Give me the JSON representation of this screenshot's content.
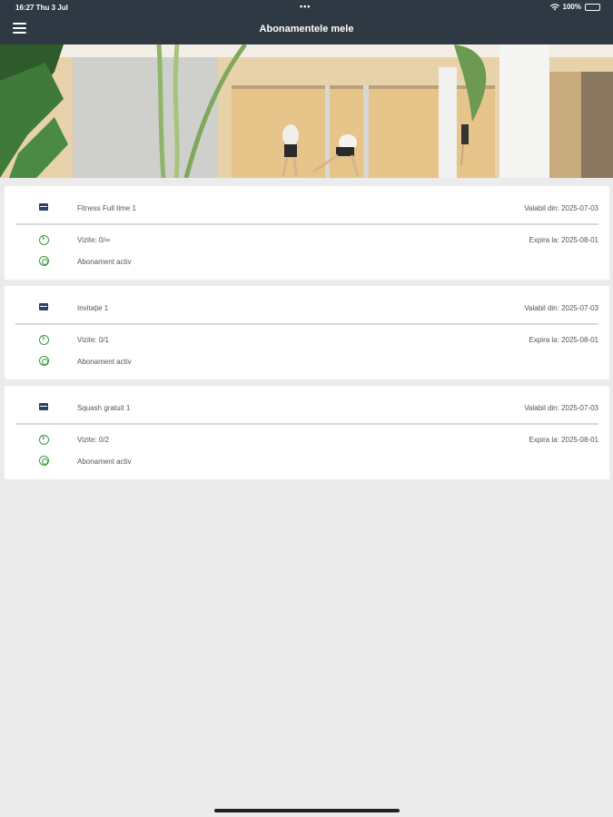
{
  "status": {
    "time_date": "16:27  Thu 3 Jul",
    "dots": "•••",
    "battery": "100%"
  },
  "nav": {
    "title": "Abonamentele mele",
    "menu_icon": "hamburger-menu-icon"
  },
  "hero": {
    "image": "squash-court-photo"
  },
  "subscriptions": [
    {
      "name": "Fitness Full time 1",
      "valid_from": "Valabil din: 2025-07-03",
      "visits": "Vizite: 0/∞",
      "expires": "Expira la: 2025-08-01",
      "status": "Abonament activ"
    },
    {
      "name": "Invitație 1",
      "valid_from": "Valabil din: 2025-07-03",
      "visits": "Vizite: 0/1",
      "expires": "Expira la: 2025-08-01",
      "status": "Abonament activ"
    },
    {
      "name": "Squash gratuit 1",
      "valid_from": "Valabil din: 2025-07-03",
      "visits": "Vizite: 0/2",
      "expires": "Expira la: 2025-08-01",
      "status": "Abonament activ"
    }
  ],
  "colors": {
    "header_bg": "#2f3943",
    "page_bg": "#ebebeb",
    "accent_green": "#3a9b3a",
    "card_icon": "#2c3e6a"
  }
}
